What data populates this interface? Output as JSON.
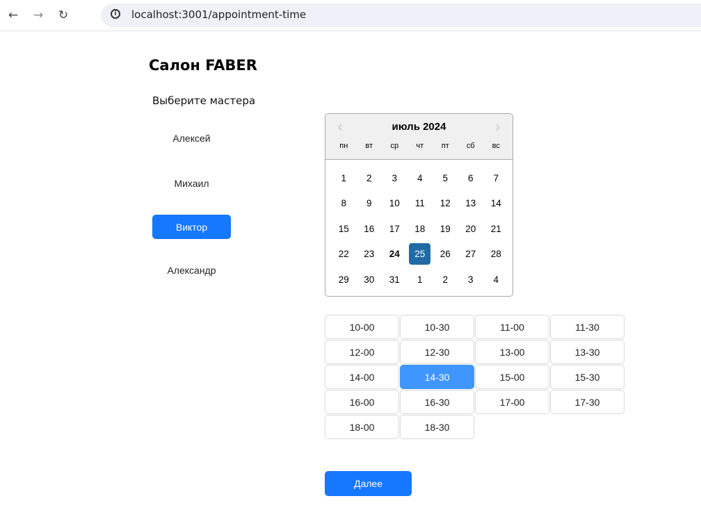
{
  "browser": {
    "back_icon": "arrow-left-icon",
    "back_glyph": "←",
    "forward_icon": "arrow-right-icon",
    "forward_glyph": "→",
    "reload_icon": "reload-icon",
    "reload_glyph": "↻",
    "info_glyph": "i",
    "url": "localhost:3001/appointment-time"
  },
  "page": {
    "title": "Салон FABER",
    "masters_heading": "Выберите мастера"
  },
  "masters": [
    {
      "name": "Алексей",
      "selected": false
    },
    {
      "name": "Михаил",
      "selected": false
    },
    {
      "name": "Виктор",
      "selected": true
    },
    {
      "name": "Александр",
      "selected": false
    }
  ],
  "calendar": {
    "month_label": "июль 2024",
    "prev_glyph": "‹",
    "next_glyph": "›",
    "weekdays": [
      "пн",
      "вт",
      "ср",
      "чт",
      "пт",
      "сб",
      "вс"
    ],
    "weeks": [
      [
        "1",
        "2",
        "3",
        "4",
        "5",
        "6",
        "7"
      ],
      [
        "8",
        "9",
        "10",
        "11",
        "12",
        "13",
        "14"
      ],
      [
        "15",
        "16",
        "17",
        "18",
        "19",
        "20",
        "21"
      ],
      [
        "22",
        "23",
        "24",
        "25",
        "26",
        "27",
        "28"
      ],
      [
        "29",
        "30",
        "31",
        "1",
        "2",
        "3",
        "4"
      ]
    ],
    "today": "24",
    "selected": "25"
  },
  "time_slots": [
    "10-00",
    "10-30",
    "11-00",
    "11-30",
    "12-00",
    "12-30",
    "13-00",
    "13-30",
    "14-00",
    "14-30",
    "15-00",
    "15-30",
    "16-00",
    "16-30",
    "17-00",
    "17-30",
    "18-00",
    "18-30"
  ],
  "selected_slot": "14-30",
  "next_button_label": "Далее",
  "colors": {
    "primary": "#1677ff",
    "slot_selected": "#4096ff",
    "calendar_selected": "#216ba5"
  }
}
